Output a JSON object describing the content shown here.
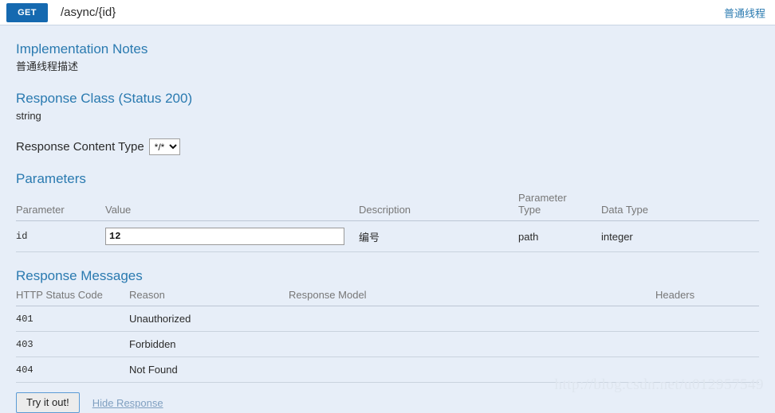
{
  "operation": {
    "method": "GET",
    "path": "/async/{id}",
    "tag_link": "普通线程"
  },
  "implementation_notes": {
    "title": "Implementation Notes",
    "text": "普通线程描述"
  },
  "response_class": {
    "title": "Response Class (Status 200)",
    "model": "string"
  },
  "response_content_type": {
    "label": "Response Content Type",
    "selected": "*/*",
    "options": [
      "*/*"
    ]
  },
  "parameters": {
    "title": "Parameters",
    "headers": {
      "parameter": "Parameter",
      "value": "Value",
      "description": "Description",
      "parameter_type_line1": "Parameter",
      "parameter_type_line2": "Type",
      "data_type": "Data Type"
    },
    "rows": [
      {
        "parameter": "id",
        "value": "12",
        "description": "编号",
        "parameter_type": "path",
        "data_type": "integer"
      }
    ]
  },
  "response_messages": {
    "title": "Response Messages",
    "headers": {
      "status_code": "HTTP Status Code",
      "reason": "Reason",
      "response_model": "Response Model",
      "headers": "Headers"
    },
    "rows": [
      {
        "status_code": "401",
        "reason": "Unauthorized",
        "response_model": "",
        "headers": ""
      },
      {
        "status_code": "403",
        "reason": "Forbidden",
        "response_model": "",
        "headers": ""
      },
      {
        "status_code": "404",
        "reason": "Not Found",
        "response_model": "",
        "headers": ""
      }
    ]
  },
  "actions": {
    "try_it_out": "Try it out!",
    "hide_response": "Hide Response"
  },
  "watermark": "http://blog.csdn.net/u012957549",
  "colors": {
    "method_badge": "#1569b0",
    "accent_heading": "#2a7ab0",
    "page_background": "#e7eef8"
  }
}
